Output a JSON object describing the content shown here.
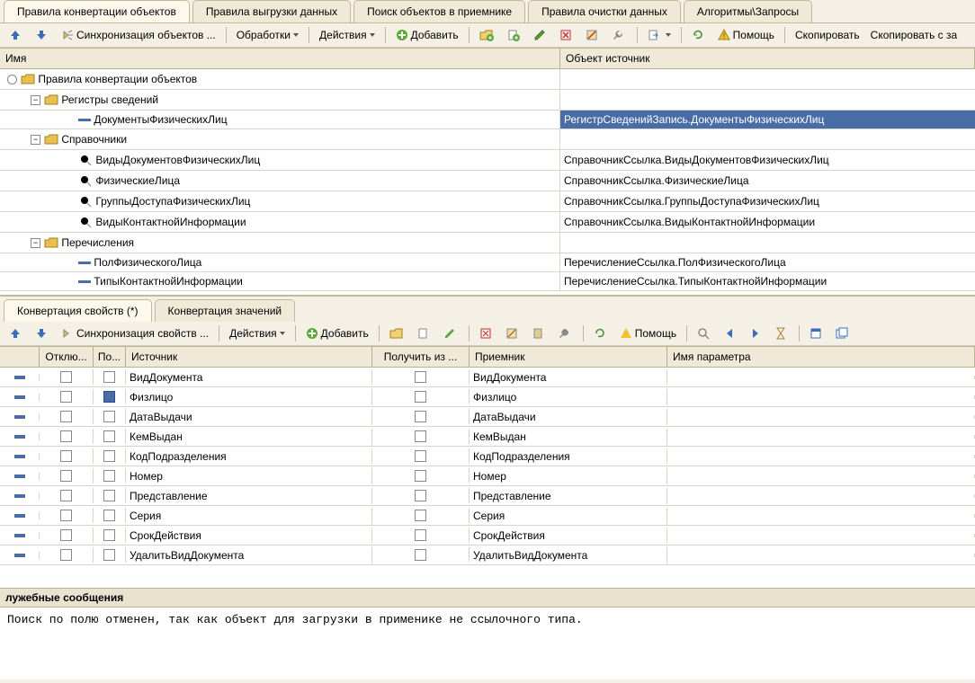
{
  "tabs": {
    "t0": "Правила конвертации объектов",
    "t1": "Правила выгрузки данных",
    "t2": "Поиск объектов в приемнике",
    "t3": "Правила очистки данных",
    "t4": "Алгоритмы\\Запросы"
  },
  "toolbar1": {
    "sync": "Синхронизация объектов ...",
    "proc": "Обработки",
    "act": "Действия",
    "add": "Добавить",
    "help": "Помощь",
    "copy": "Скопировать",
    "copywith": "Скопировать с за"
  },
  "grid": {
    "col_name": "Имя",
    "col_src": "Объект источник"
  },
  "tree": {
    "root": "Правила конвертации объектов",
    "reg": "Регистры сведений",
    "doc": "ДокументыФизическихЛиц",
    "doc_src": "РегистрСведенийЗапись.ДокументыФизическихЛиц",
    "spr": "Справочники",
    "s1": "ВидыДокументовФизическихЛиц",
    "s1s": "СправочникСсылка.ВидыДокументовФизическихЛиц",
    "s2": "ФизическиеЛица",
    "s2s": "СправочникСсылка.ФизическиеЛица",
    "s3": "ГруппыДоступаФизическихЛиц",
    "s3s": "СправочникСсылка.ГруппыДоступаФизическихЛиц",
    "s4": "ВидыКонтактнойИнформации",
    "s4s": "СправочникСсылка.ВидыКонтактнойИнформации",
    "enum": "Перечисления",
    "e1": "ПолФизическогоЛица",
    "e1s": "ПеречислениеСсылка.ПолФизическогоЛица",
    "e2": "ТипыКонтактнойИнформации",
    "e2s": "ПеречислениеСсылка.ТипыКонтактнойИнформации"
  },
  "subtabs": {
    "t0": "Конвертация свойств (*)",
    "t1": "Конвертация значений"
  },
  "toolbar2": {
    "sync": "Синхронизация свойств ...",
    "act": "Действия",
    "add": "Добавить",
    "help": "Помощь"
  },
  "props_header": {
    "off": "Отклю...",
    "po": "По...",
    "src": "Источник",
    "get": "Получить из ...",
    "dst": "Приемник",
    "param": "Имя параметра"
  },
  "props": [
    {
      "src": "ВидДокумента",
      "dst": "ВидДокумента",
      "sel": false
    },
    {
      "src": "Физлицо",
      "dst": "Физлицо",
      "sel": true
    },
    {
      "src": "ДатаВыдачи",
      "dst": "ДатаВыдачи",
      "sel": false
    },
    {
      "src": "КемВыдан",
      "dst": "КемВыдан",
      "sel": false
    },
    {
      "src": "КодПодразделения",
      "dst": "КодПодразделения",
      "sel": false
    },
    {
      "src": "Номер",
      "dst": "Номер",
      "sel": false
    },
    {
      "src": "Представление",
      "dst": "Представление",
      "sel": false
    },
    {
      "src": "Серия",
      "dst": "Серия",
      "sel": false
    },
    {
      "src": "СрокДействия",
      "dst": "СрокДействия",
      "sel": false
    },
    {
      "src": "УдалитьВидДокумента",
      "dst": "УдалитьВидДокумента",
      "sel": false
    }
  ],
  "messages": {
    "head": "лужебные сообщения",
    "body": "Поиск по полю отменен, так как объект для загрузки в применике не ссылочного типа."
  }
}
